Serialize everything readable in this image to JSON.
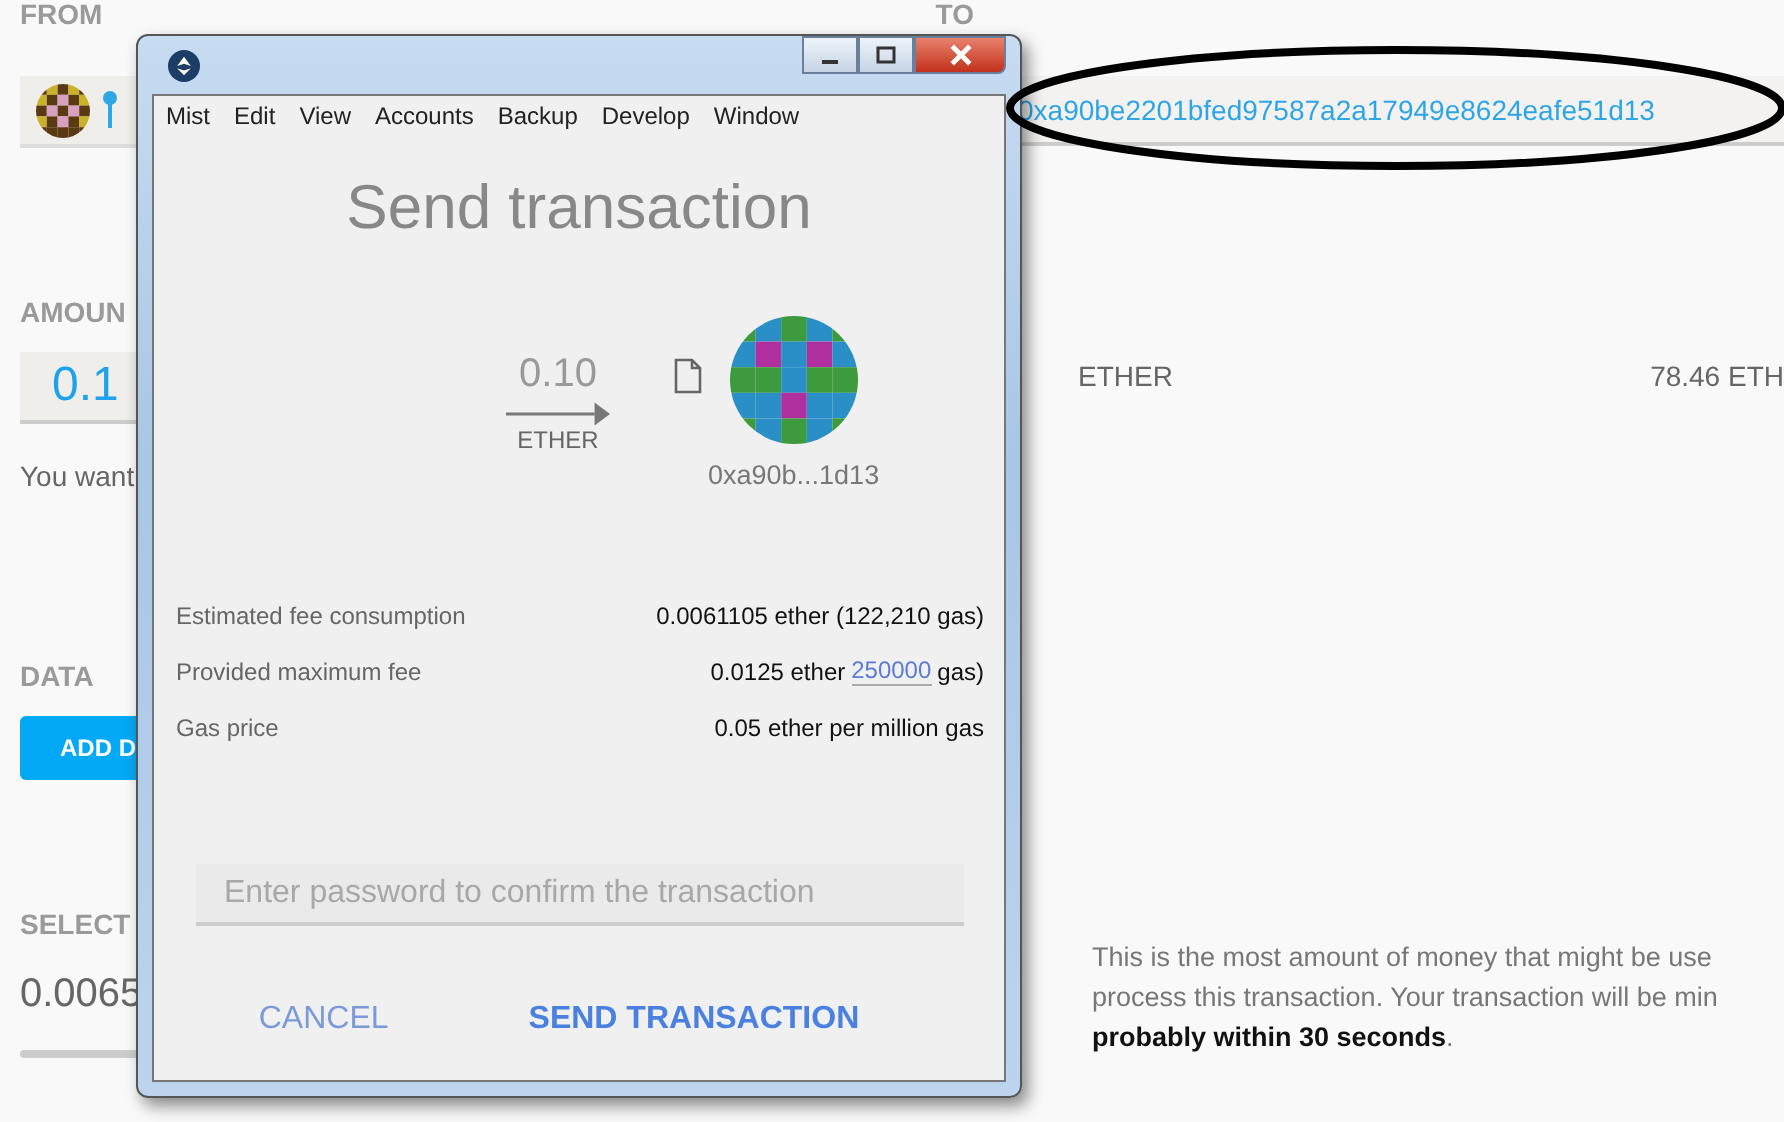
{
  "page": {
    "from_label": "FROM",
    "to_label": "TO",
    "to_address": "0xa90be2201bfed97587a2a17949e8624eafe51d13",
    "amount_label": "AMOUN",
    "amount_value": "0.1",
    "currency": "ETHER",
    "balance": "78.46 ETH",
    "amount_note": "You want",
    "data_label": "DATA",
    "add_data_button": "ADD D",
    "select_label": "SELECT",
    "fee_value": "0.0065",
    "fee_note": [
      "This is the most amount of money that might be use",
      "process this transaction. Your transaction will be min",
      "**probably within 30 seconds**."
    ]
  },
  "window": {
    "menu": [
      "Mist",
      "Edit",
      "View",
      "Accounts",
      "Backup",
      "Develop",
      "Window"
    ],
    "title": "Send transaction",
    "amount": "0.10",
    "unit": "ETHER",
    "recipient": "0xa90b...1d13",
    "fees": [
      {
        "kind": "text",
        "label": "Estimated fee consumption",
        "value": "0.0061105 ether (122,210 gas)"
      },
      {
        "kind": "gas",
        "label": "Provided maximum fee",
        "value": "0.0125 ether",
        "gas": "250000",
        "suffix": "gas)"
      },
      {
        "kind": "text",
        "label": "Gas price",
        "value": "0.05 ether per million gas"
      }
    ],
    "password": {
      "placeholder": "Enter password to confirm the transaction"
    },
    "buttons": [
      {
        "kind": "cancel",
        "label": "CANCEL"
      },
      {
        "kind": "send",
        "label": "SEND TRANSACTION"
      }
    ]
  }
}
